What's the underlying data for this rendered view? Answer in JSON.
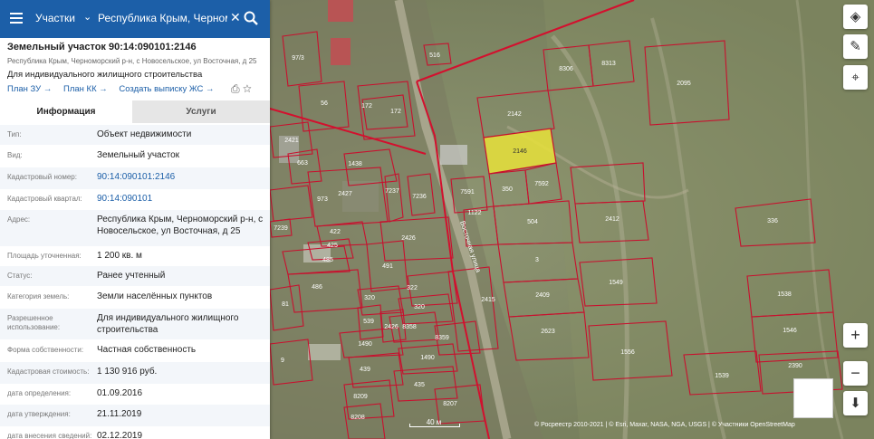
{
  "search": {
    "category": "Участки",
    "query": "Республика Крым, Черномор"
  },
  "parcel": {
    "title": "Земельный участок 90:14:090101:2146",
    "address_line": "Республика Крым, Черноморский р-н, с Новосельское, ул Восточная, д 25",
    "usage": "Для индивидуального жилищного строительства",
    "links": [
      "План ЗУ →",
      "План КК →",
      "Создать выписку ЖС →"
    ]
  },
  "tabs": [
    "Информация",
    "Услуги"
  ],
  "info": [
    {
      "label": "Тип:",
      "value": "Объект недвижимости"
    },
    {
      "label": "Вид:",
      "value": "Земельный участок"
    },
    {
      "label": "Кадастровый номер:",
      "value": "90:14:090101:2146",
      "link": true
    },
    {
      "label": "Кадастровый квартал:",
      "value": "90:14:090101",
      "link": true
    },
    {
      "label": "Адрес:",
      "value": "Республика Крым, Черноморский р-н, с Новосельское, ул Восточная, д 25"
    },
    {
      "label": "Площадь уточненная:",
      "value": "1 200 кв. м"
    },
    {
      "label": "Статус:",
      "value": "Ранее учтенный"
    },
    {
      "label": "Категория земель:",
      "value": "Земли населённых пунктов"
    },
    {
      "label": "Разрешенное использование:",
      "value": "Для индивидуального жилищного строительства"
    },
    {
      "label": "Форма собственности:",
      "value": "Частная собственность"
    },
    {
      "label": "Кадастровая стоимость:",
      "value": "1 130 916 руб."
    },
    {
      "label": "дата определения:",
      "value": "01.09.2016"
    },
    {
      "label": "дата утверждения:",
      "value": "21.11.2019"
    },
    {
      "label": "дата внесения сведений:",
      "value": "02.12.2019"
    }
  ],
  "map": {
    "street_label": "Восточная улица",
    "selected_label": "2146",
    "parcel_labels": [
      "8306",
      "8313",
      "2095",
      "2142",
      "2146",
      "350",
      "7592",
      "7591",
      "1122",
      "504",
      "2412",
      "336",
      "3",
      "1549",
      "2409",
      "2415",
      "2623",
      "1538",
      "1546",
      "1556",
      "1539",
      "2390",
      "1438",
      "2427",
      "973",
      "7237",
      "7236",
      "2426",
      "2421",
      "663",
      "56",
      "172",
      "172",
      "97/3",
      "516",
      "422",
      "425",
      "485",
      "486",
      "322",
      "320",
      "320",
      "8358",
      "8359",
      "1490",
      "1490",
      "439",
      "435",
      "8209",
      "8207",
      "8208",
      "539",
      "2426",
      "7239",
      "491",
      "81",
      "9"
    ],
    "scale_label": "40 м",
    "attribution": "© Росреестр 2010-2021 | © Esri, Maxar, NASA, NGA, USGS | © Участники OpenStreetMap",
    "colors": {
      "parcel_border": "#c8102e",
      "selected_fill": "#e8e23a",
      "panel_header": "#1c5fa8"
    }
  },
  "controls": [
    "layers-icon",
    "ruler-icon",
    "locate-icon",
    "zoom-in-icon",
    "zoom-out-icon",
    "compass-icon"
  ]
}
